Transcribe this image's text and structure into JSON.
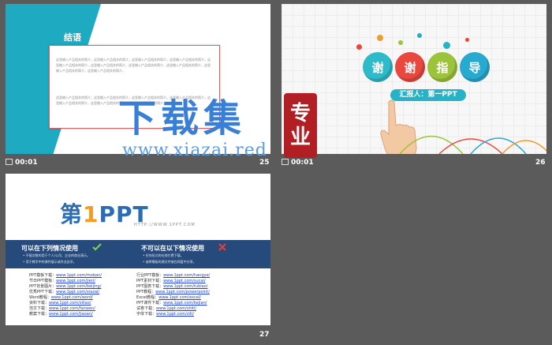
{
  "slides": [
    {
      "number": "25",
      "time": "00:01",
      "title": "结语",
      "paragraphs": [
        "这里输入产品相关的简介，这里输入产品相关的简介，这里输入产品相关的简介，这里输入产品相关的简介，这里输入产品相关的简介，这里输入产品相关的简介，这里输入产品相关的简介，这里输入产品相关的简介，这里输入产品相关的简介，这里输入产品相关的简介。",
        "这里输入产品相关的简介，这里输入产品相关的简介，这里输入产品相关的简介，这里输入产品相关的简介，这里输入产品相关的简介，这里输入产品相关的简介，这里输入产品相关的简介。"
      ]
    },
    {
      "number": "26",
      "time": "00:01",
      "thanks": [
        "谢",
        "谢",
        "指",
        "导"
      ],
      "reporter": "汇报人：第一PPT"
    },
    {
      "number": "27",
      "logo_prefix": "第",
      "logo_one": "1",
      "logo_suffix": "PPT",
      "logo_tagline": "HTTP://WWW.1PPT.COM",
      "allowed_title": "可以在下列情况使用",
      "forbidden_title": "不可以在以下情况使用",
      "allowed_items": [
        "• 不限次数的用于个人/公司、企业的商业演示。",
        "• 用于教学中的课件展示或作业自学。"
      ],
      "forbidden_items": [
        "• 任何形式的在线付费下载。",
        "• 或将模板的源文件放在网盘中分享。"
      ],
      "links_left": [
        {
          "label": "PPT模板下载：",
          "url": "www.1ppt.com/moban/"
        },
        {
          "label": "节日PPT模板：",
          "url": "www.1ppt.com/jieri/"
        },
        {
          "label": "PPT背景图片：",
          "url": "www.1ppt.com/beijing/"
        },
        {
          "label": "优秀PPT下载：",
          "url": "www.1ppt.com/xiazai/"
        },
        {
          "label": "Word教程：",
          "url": "www.1ppt.com/word/"
        },
        {
          "label": "资料下载：",
          "url": "www.1ppt.com/ziliao/"
        },
        {
          "label": "范文下载：",
          "url": "www.1ppt.com/fanwen/"
        },
        {
          "label": "教案下载：",
          "url": "www.1ppt.com/jiaoan/"
        }
      ],
      "links_right": [
        {
          "label": "行业PPT模板：",
          "url": "www.1ppt.com/hangye/"
        },
        {
          "label": "PPT素材下载：",
          "url": "www.1ppt.com/sucai/"
        },
        {
          "label": "PPT图表下载：",
          "url": "www.1ppt.com/tubiao/"
        },
        {
          "label": "PPT教程：",
          "url": "www.1ppt.com/powerpoint/"
        },
        {
          "label": "Excel教程：",
          "url": "www.1ppt.com/excel/"
        },
        {
          "label": "PPT课件下载：",
          "url": "www.1ppt.com/kejian/"
        },
        {
          "label": "试卷下载：",
          "url": "www.1ppt.com/shiti/"
        },
        {
          "label": "字体下载：",
          "url": "www.1ppt.com/ziti/"
        }
      ]
    }
  ],
  "watermark": {
    "text": "下载集",
    "seal": [
      "专",
      "业"
    ],
    "url": "www.xiazai.red"
  },
  "colors": {
    "teal": "#1eabc2",
    "navy": "#264a7c",
    "red": "#e15c5c",
    "thanks": [
      "#2dbbc9",
      "#e8483e",
      "#9cc43a",
      "#28a9cf"
    ]
  }
}
